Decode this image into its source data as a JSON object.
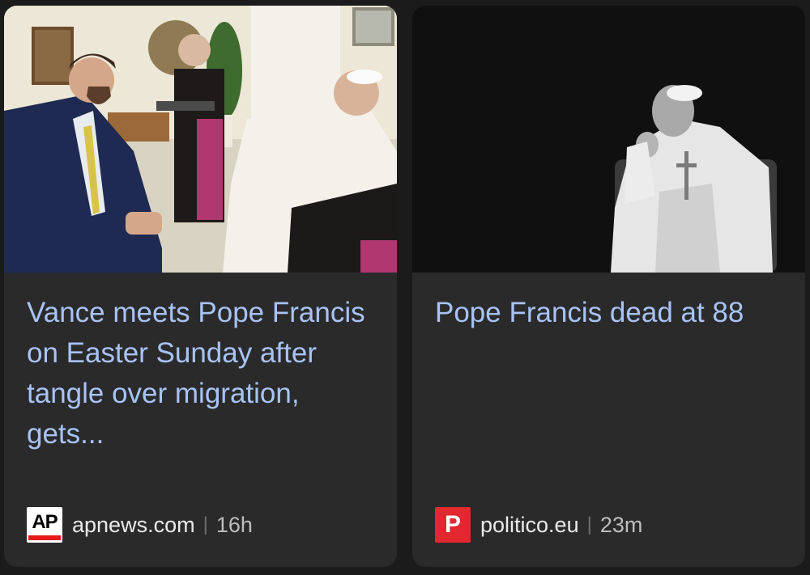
{
  "cards": [
    {
      "headline": "Vance meets Pope Francis on Easter Sunday after tangle over migration, gets...",
      "source": {
        "logo_text": "AP",
        "domain": "apnews.com",
        "separator": "|",
        "time": "16h"
      }
    },
    {
      "headline": "Pope Francis dead at 88",
      "source": {
        "logo_text": "P",
        "domain": "politico.eu",
        "separator": "|",
        "time": "23m"
      }
    }
  ],
  "colors": {
    "background": "#1b1b1c",
    "card": "#2a2a2b",
    "headline": "#a8c3f5",
    "ap_red": "#e8191a",
    "politico_red": "#e4282f"
  }
}
